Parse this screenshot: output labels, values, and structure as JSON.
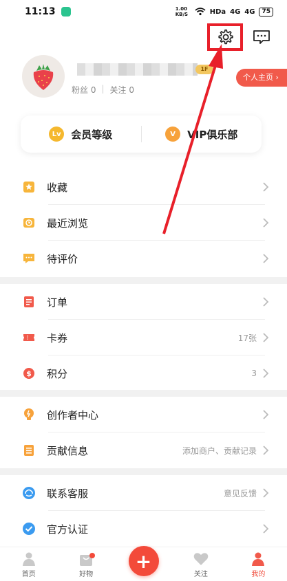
{
  "status_bar": {
    "time": "11:13",
    "network_speed": "1.00 KB/S",
    "hd": "HDa",
    "signal1": "4G",
    "signal2": "4G",
    "battery": "75"
  },
  "header": {
    "settings_icon": "gear-icon",
    "message_icon": "chat-icon"
  },
  "profile": {
    "avatar_icon": "strawberry-icon",
    "followers_label": "粉丝",
    "followers": "0",
    "following_label": "关注",
    "following": "0",
    "level_badge": "1F",
    "homepage_button": "个人主页"
  },
  "member_card": {
    "level_label": "会员等级",
    "level_badge": "Lv",
    "vip_label": "VIP俱乐部",
    "vip_badge": "V"
  },
  "group1": [
    {
      "label": "收藏",
      "icon": "star-icon",
      "value": ""
    },
    {
      "label": "最近浏览",
      "icon": "clock-icon",
      "value": ""
    },
    {
      "label": "待评价",
      "icon": "comment-icon",
      "value": ""
    }
  ],
  "group2": [
    {
      "label": "订单",
      "icon": "order-icon",
      "value": ""
    },
    {
      "label": "卡券",
      "icon": "ticket-icon",
      "value": "17张"
    },
    {
      "label": "积分",
      "icon": "coin-icon",
      "value": "3"
    }
  ],
  "group3": [
    {
      "label": "创作者中心",
      "icon": "bulb-icon",
      "value": ""
    },
    {
      "label": "贡献信息",
      "icon": "doc-icon",
      "value": "添加商户、贡献记录"
    }
  ],
  "group4": [
    {
      "label": "联系客服",
      "icon": "headset-icon",
      "value": "意见反馈"
    },
    {
      "label": "官方认证",
      "icon": "verified-icon",
      "value": ""
    }
  ],
  "bottom_nav": [
    {
      "label": "首页",
      "icon": "home-icon"
    },
    {
      "label": "好物",
      "icon": "bag-icon"
    },
    {
      "label": "",
      "icon": "plus-icon"
    },
    {
      "label": "关注",
      "icon": "heart-icon"
    },
    {
      "label": "我的",
      "icon": "person-icon"
    }
  ],
  "colors": {
    "accent": "#f15a4b",
    "annotation": "#e8202a",
    "orange": "#f7a23b",
    "blue": "#3b9bf0"
  }
}
